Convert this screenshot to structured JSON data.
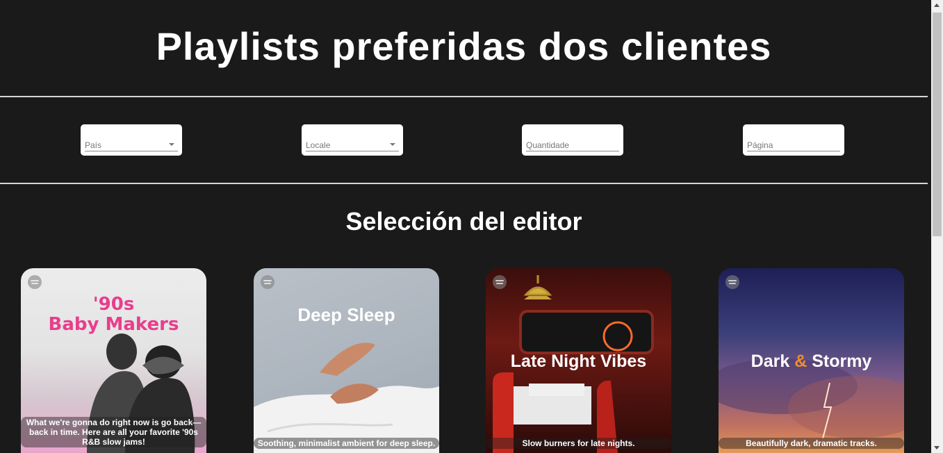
{
  "header": {
    "title": "Playlists preferidas dos clientes"
  },
  "filters": [
    {
      "label": "País",
      "type": "select"
    },
    {
      "label": "Locale",
      "type": "select"
    },
    {
      "label": "Quantidade",
      "type": "input"
    },
    {
      "label": "Página",
      "type": "input"
    }
  ],
  "section": {
    "title": "Selección del editor"
  },
  "playlists": [
    {
      "art_title_1": "'90s",
      "art_title_2": "Baby Makers",
      "description": "What we're gonna do right now is go back—back in time. Here are all your favorite '90s R&B slow jams!",
      "color": "#e83e8c"
    },
    {
      "art_title": "Deep Sleep",
      "description": "Soothing, minimalist ambient for deep sleep."
    },
    {
      "art_title": "Late Night Vibes",
      "description": "Slow burners for late nights."
    },
    {
      "art_title_1": "Dark",
      "art_title_amp": "&",
      "art_title_2": "Stormy",
      "description": "Beautifully dark, dramatic tracks."
    }
  ],
  "colors": {
    "background": "#1b1a1a",
    "accent_pink": "#e83e8c",
    "accent_orange": "#f08c2a"
  }
}
